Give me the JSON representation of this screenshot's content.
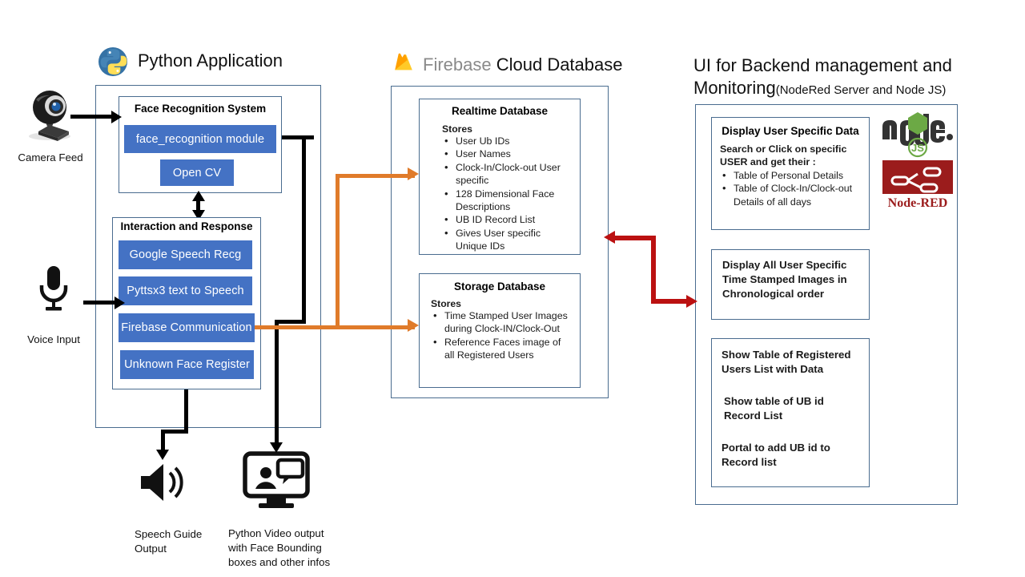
{
  "python_section": {
    "title": "Python Application",
    "logo": "python-logo",
    "face_recognition": {
      "header": "Face Recognition System",
      "modules": [
        {
          "label": "face_recognition module"
        },
        {
          "label": "Open CV"
        }
      ]
    },
    "interaction": {
      "header": "Interaction and Response",
      "modules": [
        {
          "label": "Google Speech Recg"
        },
        {
          "label": "Pyttsx3 text to Speech"
        },
        {
          "label": "Firebase Communication"
        },
        {
          "label": "Unknown Face Register"
        }
      ]
    }
  },
  "firebase_section": {
    "title_brand": "Firebase",
    "title_rest": "Cloud Database",
    "logo": "firebase-logo",
    "realtime_db": {
      "header": "Realtime Database",
      "stores_label": "Stores",
      "items": [
        "User Ub IDs",
        "User Names",
        "Clock-In/Clock-out User specific",
        "128 Dimensional Face Descriptions",
        "UB ID Record List",
        "Gives User specific Unique IDs"
      ]
    },
    "storage_db": {
      "header": "Storage Database",
      "stores_label": "Stores",
      "items": [
        "Time Stamped  User Images during Clock-IN/Clock-Out",
        "Reference  Faces image of all Registered Users"
      ]
    }
  },
  "ui_section": {
    "title_main": "UI for Backend management and Monitoring",
    "title_paren": "(NodeRed Server  and Node JS)",
    "logos": [
      {
        "name": "nodejs-logo",
        "label": "node",
        "sublabel": "JS"
      },
      {
        "name": "node-red-logo",
        "label": "Node-RED"
      }
    ],
    "cards": [
      {
        "header": "Display User Specific Data",
        "subtext": "Search or Click on specific  USER and get their :",
        "items": [
          "Table of Personal Details",
          "Table of Clock-In/Clock-out Details of all days"
        ]
      },
      {
        "lines": [
          "Display All User Specific",
          "Time Stamped Images in",
          "Chronological order"
        ]
      },
      {
        "blocks": [
          "Show Table of Registered Users List with Data",
          "Show table of UB id Record List",
          "Portal to add UB id to Record list"
        ]
      }
    ]
  },
  "io": {
    "camera": {
      "label": "Camera Feed",
      "icon": "webcam-icon"
    },
    "voice": {
      "label": "Voice Input",
      "icon": "microphone-icon"
    },
    "speech_out": {
      "label": "Speech Guide Output",
      "icon": "speaker-icon"
    },
    "video_out": {
      "label": "Python Video output with Face Bounding boxes and other infos",
      "icon": "monitor-icon"
    }
  },
  "colors": {
    "chip_blue": "#4472C4",
    "box_border": "#4A6C8F",
    "arrow_black": "#000000",
    "arrow_orange": "#E07B2A",
    "arrow_red": "#BB1111",
    "node_green": "#6CA945",
    "node_red": "#9B1C1C"
  }
}
